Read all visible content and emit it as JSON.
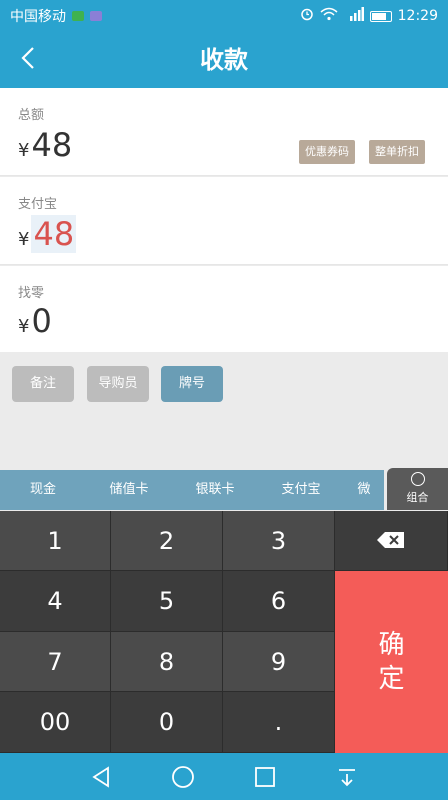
{
  "status_bar": {
    "carrier": "中国移动",
    "time": "12:29",
    "colors": {
      "sim1": "#3fb24f",
      "sim2": "#8b7fd6"
    },
    "icons": [
      "alarm-icon",
      "wifi-icon",
      "signal-icon",
      "battery-icon"
    ]
  },
  "header": {
    "title": "收款",
    "back_icon": "chevron-left-icon"
  },
  "total": {
    "label": "总额",
    "currency": "¥",
    "value": "48"
  },
  "discount_buttons": {
    "coupon": "优惠券码",
    "order_discount": "整单折扣"
  },
  "alipay": {
    "label": "支付宝",
    "currency": "¥",
    "value": "48"
  },
  "change": {
    "label": "找零",
    "currency": "¥",
    "value": "0"
  },
  "tags": {
    "note": "备注",
    "guide": "导购员",
    "plate": "牌号"
  },
  "payment_tabs": [
    "现金",
    "储值卡",
    "银联卡",
    "支付宝",
    "微"
  ],
  "combo": {
    "label": "组合"
  },
  "keypad": {
    "keys": [
      "1",
      "2",
      "3",
      "4",
      "5",
      "6",
      "7",
      "8",
      "9",
      "00",
      "0",
      "."
    ],
    "confirm_line1": "确",
    "confirm_line2": "定",
    "backspace_icon": "backspace-icon"
  },
  "accent_colors": {
    "primary": "#2aa3cf",
    "confirm": "#f45c58",
    "amount_highlight": "#d9534f"
  }
}
